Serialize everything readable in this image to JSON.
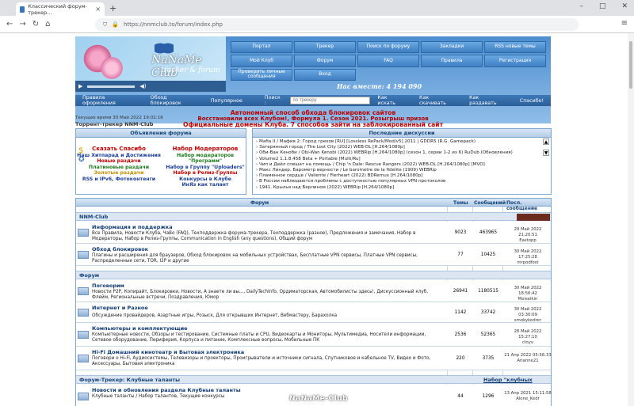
{
  "browser": {
    "tab_title": "Классический форум-трекер...",
    "url": "https://nnmclub.to/forum/index.php"
  },
  "header": {
    "logo_title": "NaNaMe Club",
    "logo_subtitle": "tracker & forum",
    "online": "Нас вместе: 4 194 090",
    "nav": [
      [
        "Портал",
        "Трекер",
        "Поиск по форуму",
        "Закладки",
        "RSS новые темы",
        "Мой Клуб"
      ],
      [
        "Форум",
        "FAQ",
        "Правила",
        "Регистрация",
        "Проверить личные сообщения",
        "Вход"
      ]
    ],
    "subnav": [
      "Правила оформления",
      "Обход блокировок",
      "Популярное",
      "Поиск :",
      "Как искать",
      "Как скачивать",
      "Как раздавать",
      "Спасибо!"
    ],
    "search_placeholder": "по трекеру"
  },
  "announcements": {
    "line1": "Автономный способ обхода блокировок сайтов",
    "line2": "Восстановили всех Клубом!, Формула 1. Сезон 2021. Розыгрыш призов",
    "line3": "Официальные домены Клуба. 7 способов зайти на заблокированный сайт",
    "time": "Текущее время 30 Май 2022 19:02:16",
    "tracker": "Торрент-трекер NNM-Club"
  },
  "left_box": {
    "title": "Объявления форума",
    "left": [
      "Сказать Спасибо",
      "Наш Хитпарад и Достижения",
      "Новые раздачи",
      "Платиновые раздачи",
      "Золотые раздачи",
      "RSS и IPv6, Фотоконтенги"
    ],
    "right": [
      "Набор Модераторов",
      "Набор модераторов \"Программ\"",
      "Набор в Группу \"Uploaders\"",
      "Набор в Релиз-Группы",
      "Конкурсы в Клубе",
      "ИнЯз как талант"
    ]
  },
  "right_box": {
    "title": "Последние дискуссии",
    "items": [
      "› Mafia II / Мафия 2: Город грехов [RU] [Lossless RePack/Mod/v5] 2011 | GDDR5 (R.G. Gamepack)",
      "› Затерянный город / The Lost City (2022) WEB-DL [H.264/1080p]",
      "› Оби-Ван Кеноби / Obi-Wan Kenobi (2022) WEBRip [H.264/1080p] (сезон 1, серии 1-2 из 6) RuDub (Обновления)",
      "› Volume2 1.1.8.458 Beta + Portable [Multi/Ru]",
      "› Чип и Дейл спешат на помощь / Chip 'n Dale: Rescue Rangers (2022) WEB-DL [H.264/1080p] [MVO]",
      "› Макс Линдер. Барометр верности / Le barometre de la fidelite (1909) WEBRip",
      "› Пламенное сердце / Valiente / Fierheart (2022) BDRemux [H.264/1080p]",
      "› В России наблюдаются проблемы с доступностью популярных VPN протоколов",
      "› 1941. Крылья над Берлином (2022) WEBRip [H.264/1080p]"
    ]
  },
  "forum": {
    "head_title": "Форум",
    "col_topics": "Темы",
    "col_posts": "Сообщений",
    "col_last": "Посл. сообщение",
    "cat1": "NNM-Club",
    "cat2": "Форум",
    "cat3": "Форум-Трекер: Клубные таланты",
    "cat3_link": "Набор \"клубных талантов\"",
    "rows": [
      {
        "title": "Информация и поддержка",
        "sub": "Все Правила, Новости Клуба, ЧаВо (FAQ), Техподдержка форума-трекера, Техподдержка (разное), Предложения и замечания, Набор в Модераторы, Набор в Релиз-Группы, Communication in English (any questions), Общий форум",
        "topics": "9023",
        "posts": "463965",
        "last1": "29 Май 2022 21:20:51",
        "last2": "Eastopp"
      },
      {
        "title": "Обход блокировок",
        "sub": "Плагины и расширения для браузеров, Обход блокировок на мобильных устройствах, Бесплатные VPN сервисы, Платные VPN сервисы, Распределенные сети, TOR, I2P и другие",
        "topics": "77",
        "posts": "10425",
        "last1": "30 Май 2022 17:25:28",
        "last2": "mrpodfost"
      },
      {
        "title": "Поговорим",
        "sub": "Новости P2P, Копирайт, Блокировки, Новости, A знаете ли вы..., DailyTechInfo, Ордиматорская, Автомобилисты здесь!, Дискуссионный клуб, Флейм, Региональные встречи, Поздравления, Юмор",
        "topics": "26941",
        "posts": "1180515",
        "last1": "30 Май 2022 18:56:42",
        "last2": "Moiseikin"
      },
      {
        "title": "Интернет и Разное",
        "sub": "Обсуждение провайдеров, Азартные игры, Розыск, Для открывших Интернет, Вебмастеру, Барахолка",
        "topics": "1142",
        "posts": "33742",
        "last1": "30 Май 2022 03:30:09",
        "last2": "smokykedrer"
      },
      {
        "title": "Компьютеры и комплектующие",
        "sub": "Компьютерные новости, Обзоры и тестирование, Системные платы и CPU, Видеокарты и Мониторы, Мультимедиа, Носители информации, Сетевое оборудование, Периферия, Корпуса и питание, Комплексные вопросы, Мобильные ПК",
        "topics": "2536",
        "posts": "52365",
        "last1": "28 Май 2022 15:27:10",
        "last2": "clnyv"
      },
      {
        "title": "Hi-Fi Домашний кинотеатр и Бытовая электроника",
        "sub": "Поговори о Hi-Fi, Аудиосистемы, Телевизоры и проекторы, Проигрыватели и источники сигнала, Спутниковое и кабельное TV, Видео и Фото, Аксессуары, Бытовая электроника",
        "topics": "220",
        "posts": "3735",
        "last1": "21 Апр 2022 05:56:33",
        "last2": "Arianne21"
      },
      {
        "title": "Новости и обновления раздела Клубные таланты",
        "sub": "Клубные таланты / Набор талантов, Текущие конкурсы",
        "topics": "44",
        "posts": "1296",
        "last1": "13 Апр 2021 15:11:58",
        "last2": "Alone_Kedr"
      }
    ]
  },
  "watermark": "NaNaMe-Club"
}
